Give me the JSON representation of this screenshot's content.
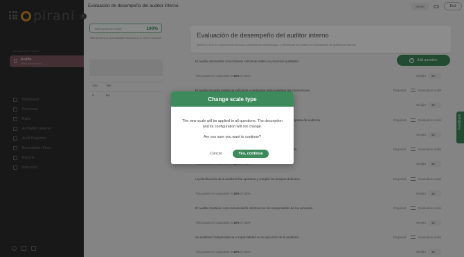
{
  "app": {
    "logo_text": "pirani"
  },
  "sidebar": {
    "section_label": "Management module",
    "module": {
      "title": "Audits",
      "subtitle": "Pirani Management"
    },
    "items": [
      {
        "label": "Dashboard",
        "icon": "monitor-icon"
      },
      {
        "label": "Processes",
        "icon": "process-icon"
      },
      {
        "label": "Risks",
        "icon": "risk-icon"
      },
      {
        "label": "Auditable Universe",
        "icon": "universe-icon"
      },
      {
        "label": "Audit Programs",
        "icon": "programs-icon"
      },
      {
        "label": "Remediation Plans",
        "icon": "plans-icon"
      },
      {
        "label": "Reports",
        "icon": "reports-icon"
      },
      {
        "label": "Indicators",
        "icon": "indicators-icon"
      }
    ]
  },
  "topbar": {
    "title": "Evaluación de desempeño del auditor interno",
    "saved_label": "Saved",
    "exit_label": "Exit"
  },
  "config_panel": {
    "score_label": "Total questions weight",
    "score_value": "100%",
    "note": "Total questions in your evaluation must add up to 100% to continue",
    "options": [
      {
        "value": "100",
        "label": "Yes"
      },
      {
        "value": "0",
        "label": "No"
      }
    ]
  },
  "evaluation": {
    "title": "Evaluación de desempeño del auditor interno",
    "description": "Medir en nivel de competencia técnica, cumplimiento metodológico y efectividad del auditor en el desarrollo de auditorías internas.",
    "add_question_label": "Add question",
    "required_label": "Required",
    "scale_label": "Evaluation scale",
    "weight_label": "Weight",
    "equivalent_prefix": "This question is equivalent to",
    "equivalent_suffix": "of 100%",
    "questions": [
      {
        "text": "El auditor demuestra conocimiento suficiente sobre los procesos auditados.",
        "percent": "10%",
        "weight": "10"
      },
      {
        "text": "El auditor recopila evidencia suficiente y pertinente para sustentar las conclusiones.",
        "percent": "10%",
        "weight": "10"
      },
      {
        "text": "El auditor aplica adecuadamente los procedimientos definidos en el programa de auditoría.",
        "percent": "10%",
        "weight": "10"
      },
      {
        "text": "Los hallazgos reportados son claros, objetivos y con evidencia verificable.",
        "percent": "10%",
        "weight": "10"
      },
      {
        "text": "La planificación de la auditoría fue oportuna y cumplió los tiempos definidos.",
        "percent": "10%",
        "weight": "10"
      },
      {
        "text": "El auditor mantiene una comunicación efectiva con los responsables de los procesos.",
        "percent": "10%",
        "weight": "10"
      },
      {
        "text": "Se evidenció independencia e imparcialidad en la ejecución de la auditoría.",
        "percent": "10%",
        "weight": "10"
      }
    ]
  },
  "feedback_label": "Feedback",
  "modal": {
    "title": "Change scale type",
    "message": "The new scale will be applied to all questions. The description and its configuration will not change.",
    "question": "Are you sure you want to continue?",
    "cancel_label": "Cancel",
    "confirm_label": "Yes, continue"
  },
  "colors": {
    "primary": "#3d8a5c",
    "accent": "#d68a2e",
    "sidebar": "#2c2c2c"
  }
}
